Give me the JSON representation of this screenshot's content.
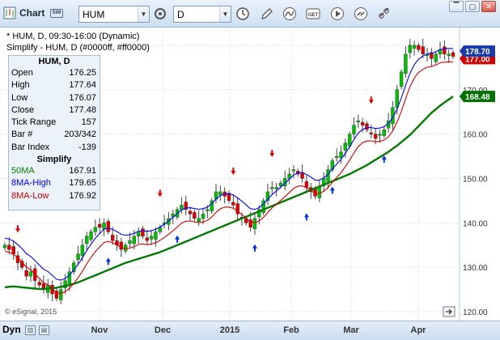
{
  "toolbar": {
    "title": "Chart",
    "sim_badge": "SIM",
    "symbol": "HUM",
    "interval": "D",
    "icons": [
      "settings-icon",
      "clock-icon",
      "pencil-icon",
      "curve-icon",
      "get-icon",
      "play-icon",
      "link-icon",
      "chain-icon"
    ]
  },
  "chart": {
    "header_line1": "* HUM, D, 09:30-16:00 (Dynamic)",
    "header_line2": "Simplify - HUM, D (#0000ff, #ff0000)",
    "copyright": "© eSignal, 2015",
    "price_labels": [
      "130.00",
      "140.00",
      "150.00",
      "160.00",
      "170.00",
      "120.00"
    ],
    "badges": {
      "last": "178.70",
      "ma_low": "177.00",
      "ma50": "168.48"
    },
    "colors": {
      "up": "#00c000",
      "down": "#e00000",
      "ma50": "#007000",
      "ma_high": "#0000ff",
      "ma_low": "#d00000"
    }
  },
  "data_window": {
    "title": "HUM, D",
    "rows": [
      {
        "label": "Open",
        "value": "176.25"
      },
      {
        "label": "High",
        "value": "177.64"
      },
      {
        "label": "Low",
        "value": "176.07"
      },
      {
        "label": "Close",
        "value": "177.48"
      },
      {
        "label": "Tick Range",
        "value": "157"
      },
      {
        "label": "Bar #",
        "value": "203/342"
      },
      {
        "label": "Bar Index",
        "value": "-139"
      }
    ],
    "section": "Simplify",
    "indicators": [
      {
        "label": "50MA",
        "value": "167.91",
        "color": "#008000"
      },
      {
        "label": "8MA-High",
        "value": "179.65",
        "color": "#0000ff"
      },
      {
        "label": "8MA-Low",
        "value": "176.92",
        "color": "#d00000"
      }
    ]
  },
  "bottom": {
    "mode": "Dyn",
    "x_labels": [
      "Nov",
      "Dec",
      "2015",
      "Feb",
      "Mar",
      "Apr"
    ]
  },
  "chart_data": {
    "type": "candlestick",
    "yrange": [
      118,
      184
    ],
    "closes": [
      135,
      134,
      133,
      131,
      130,
      128,
      129,
      127,
      126,
      125,
      126,
      124,
      123,
      125,
      127,
      129,
      131,
      133,
      135,
      137,
      138,
      139,
      139,
      140,
      138,
      136,
      135,
      134,
      135,
      136,
      137,
      138,
      137,
      136,
      137,
      138,
      139,
      140,
      141,
      142,
      143,
      144,
      143,
      142,
      141,
      141,
      142,
      143,
      145,
      147,
      147,
      146,
      145,
      144,
      142,
      141,
      140,
      139,
      141,
      143,
      145,
      147,
      148,
      148,
      149,
      150,
      151,
      152,
      151,
      150,
      148,
      147,
      146,
      148,
      150,
      152,
      154,
      155,
      156,
      158,
      160,
      162,
      163,
      162,
      161,
      160,
      159,
      160,
      161,
      163,
      166,
      170,
      174,
      178,
      180,
      180,
      179,
      178,
      178,
      177,
      178,
      179,
      178,
      178,
      177.48
    ],
    "ma50": [
      125.5,
      125.6,
      125.7,
      125.6,
      125.5,
      125.4,
      125.3,
      125.2,
      125.1,
      125.1,
      125.2,
      125.3,
      125.4,
      125.6,
      125.8,
      126.0,
      126.3,
      126.6,
      127.0,
      127.4,
      127.8,
      128.2,
      128.6,
      129.0,
      129.4,
      129.8,
      130.2,
      130.6,
      131.0,
      131.3,
      131.6,
      131.9,
      132.2,
      132.5,
      132.8,
      133.1,
      133.4,
      133.8,
      134.2,
      134.6,
      135.0,
      135.4,
      135.8,
      136.2,
      136.6,
      137.0,
      137.4,
      137.8,
      138.2,
      138.6,
      139.0,
      139.4,
      139.8,
      140.2,
      140.6,
      141.0,
      141.4,
      141.8,
      142.2,
      142.6,
      143.0,
      143.4,
      143.8,
      144.2,
      144.6,
      145.0,
      145.4,
      145.8,
      146.2,
      146.6,
      147.0,
      147.4,
      147.8,
      148.2,
      148.6,
      149.0,
      149.4,
      149.8,
      150.2,
      150.6,
      151.0,
      151.5,
      152.0,
      152.5,
      153.0,
      153.6,
      154.2,
      154.8,
      155.4,
      156.0,
      156.7,
      157.4,
      158.2,
      159.0,
      159.8,
      160.8,
      161.8,
      162.8,
      163.8,
      164.8,
      165.6,
      166.4,
      167.1,
      167.8,
      168.48
    ]
  }
}
